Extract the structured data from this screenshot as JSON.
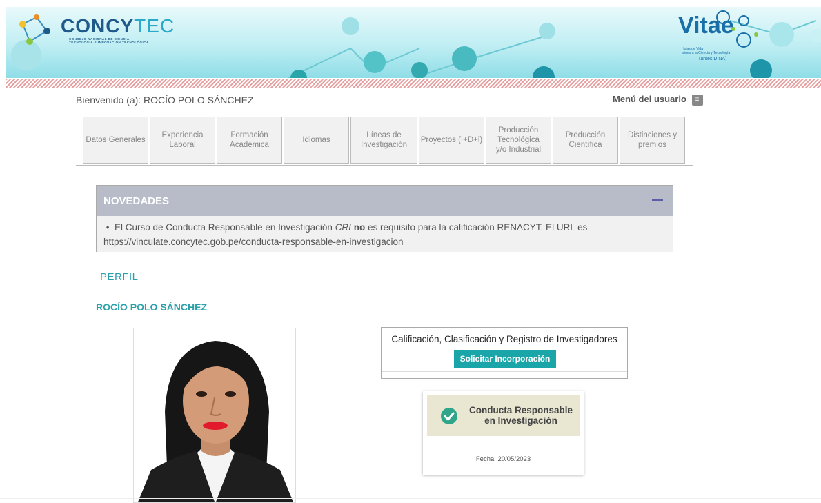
{
  "header": {
    "logo_main": "CONCY",
    "logo_accent": "TEC",
    "logo_subtitle_1": "CONSEJO NACIONAL DE CIENCIA,",
    "logo_subtitle_2": "TECNOLOGÍA E INNOVACIÓN TECNOLÓGICA",
    "cti_title": "Vitae",
    "cti_subtitle_1": "Hojas de Vida",
    "cti_subtitle_2": "afines a la Ciencia y Tecnología",
    "cti_subtitle_3": "(antes DINA)"
  },
  "welcome": {
    "label": "Bienvenido (a): ROCÍO POLO SÁNCHEZ"
  },
  "user_menu": {
    "label": "Menú del usuario",
    "icon": "menu-list-icon"
  },
  "tabs": [
    {
      "label": "Datos Generales"
    },
    {
      "label": "Experiencia Laboral"
    },
    {
      "label": "Formación Académica"
    },
    {
      "label": "Idiomas"
    },
    {
      "label": "Líneas de Investigación"
    },
    {
      "label": "Proyectos (I+D+i)"
    },
    {
      "label": "Producción Tecnológica y/o Industrial"
    },
    {
      "label": "Producción Científica"
    },
    {
      "label": "Distinciones y premios"
    }
  ],
  "novedades": {
    "title": "NOVEDADES",
    "text_before": "El Curso de Conducta Responsable en Investigación ",
    "text_em": "CRI",
    "text_bold": "no",
    "text_after": " es requisito para la calificación RENACYT. El URL es",
    "url": "https://vinculate.concytec.gob.pe/conducta-responsable-en-investigacion"
  },
  "perfil": {
    "section_title": "PERFIL",
    "name": "ROCÍO POLO SÁNCHEZ"
  },
  "renacyt": {
    "title": "Calificación, Clasificación y Registro de Investigadores",
    "button_label": "Solicitar Incorporación"
  },
  "cri_badge": {
    "line1": "Conducta Responsable",
    "line2": "en Investigación",
    "date": "Fecha: 20/05/2023"
  },
  "colors": {
    "accent": "#2aa0ab",
    "button": "#1aa5a9",
    "nov_header": "#b8bcc9"
  }
}
